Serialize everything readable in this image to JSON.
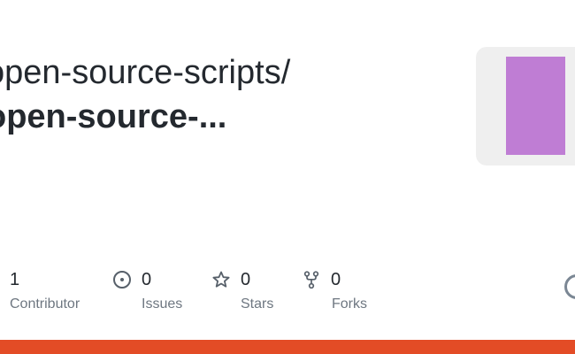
{
  "repo": {
    "owner_line": "open-source-scripts/",
    "name_line": "open-source-..."
  },
  "stats": [
    {
      "count": "1",
      "label": "Contributor",
      "icon": "people-icon"
    },
    {
      "count": "0",
      "label": "Issues",
      "icon": "issue-circle-icon"
    },
    {
      "count": "0",
      "label": "Stars",
      "icon": "star-icon"
    },
    {
      "count": "0",
      "label": "Forks",
      "icon": "fork-icon"
    }
  ],
  "colors": {
    "language_bar": "#e34c26",
    "preview_square": "#bf7dd4",
    "preview_card": "#efefef",
    "text": "#24292f",
    "muted": "#6e7781"
  }
}
